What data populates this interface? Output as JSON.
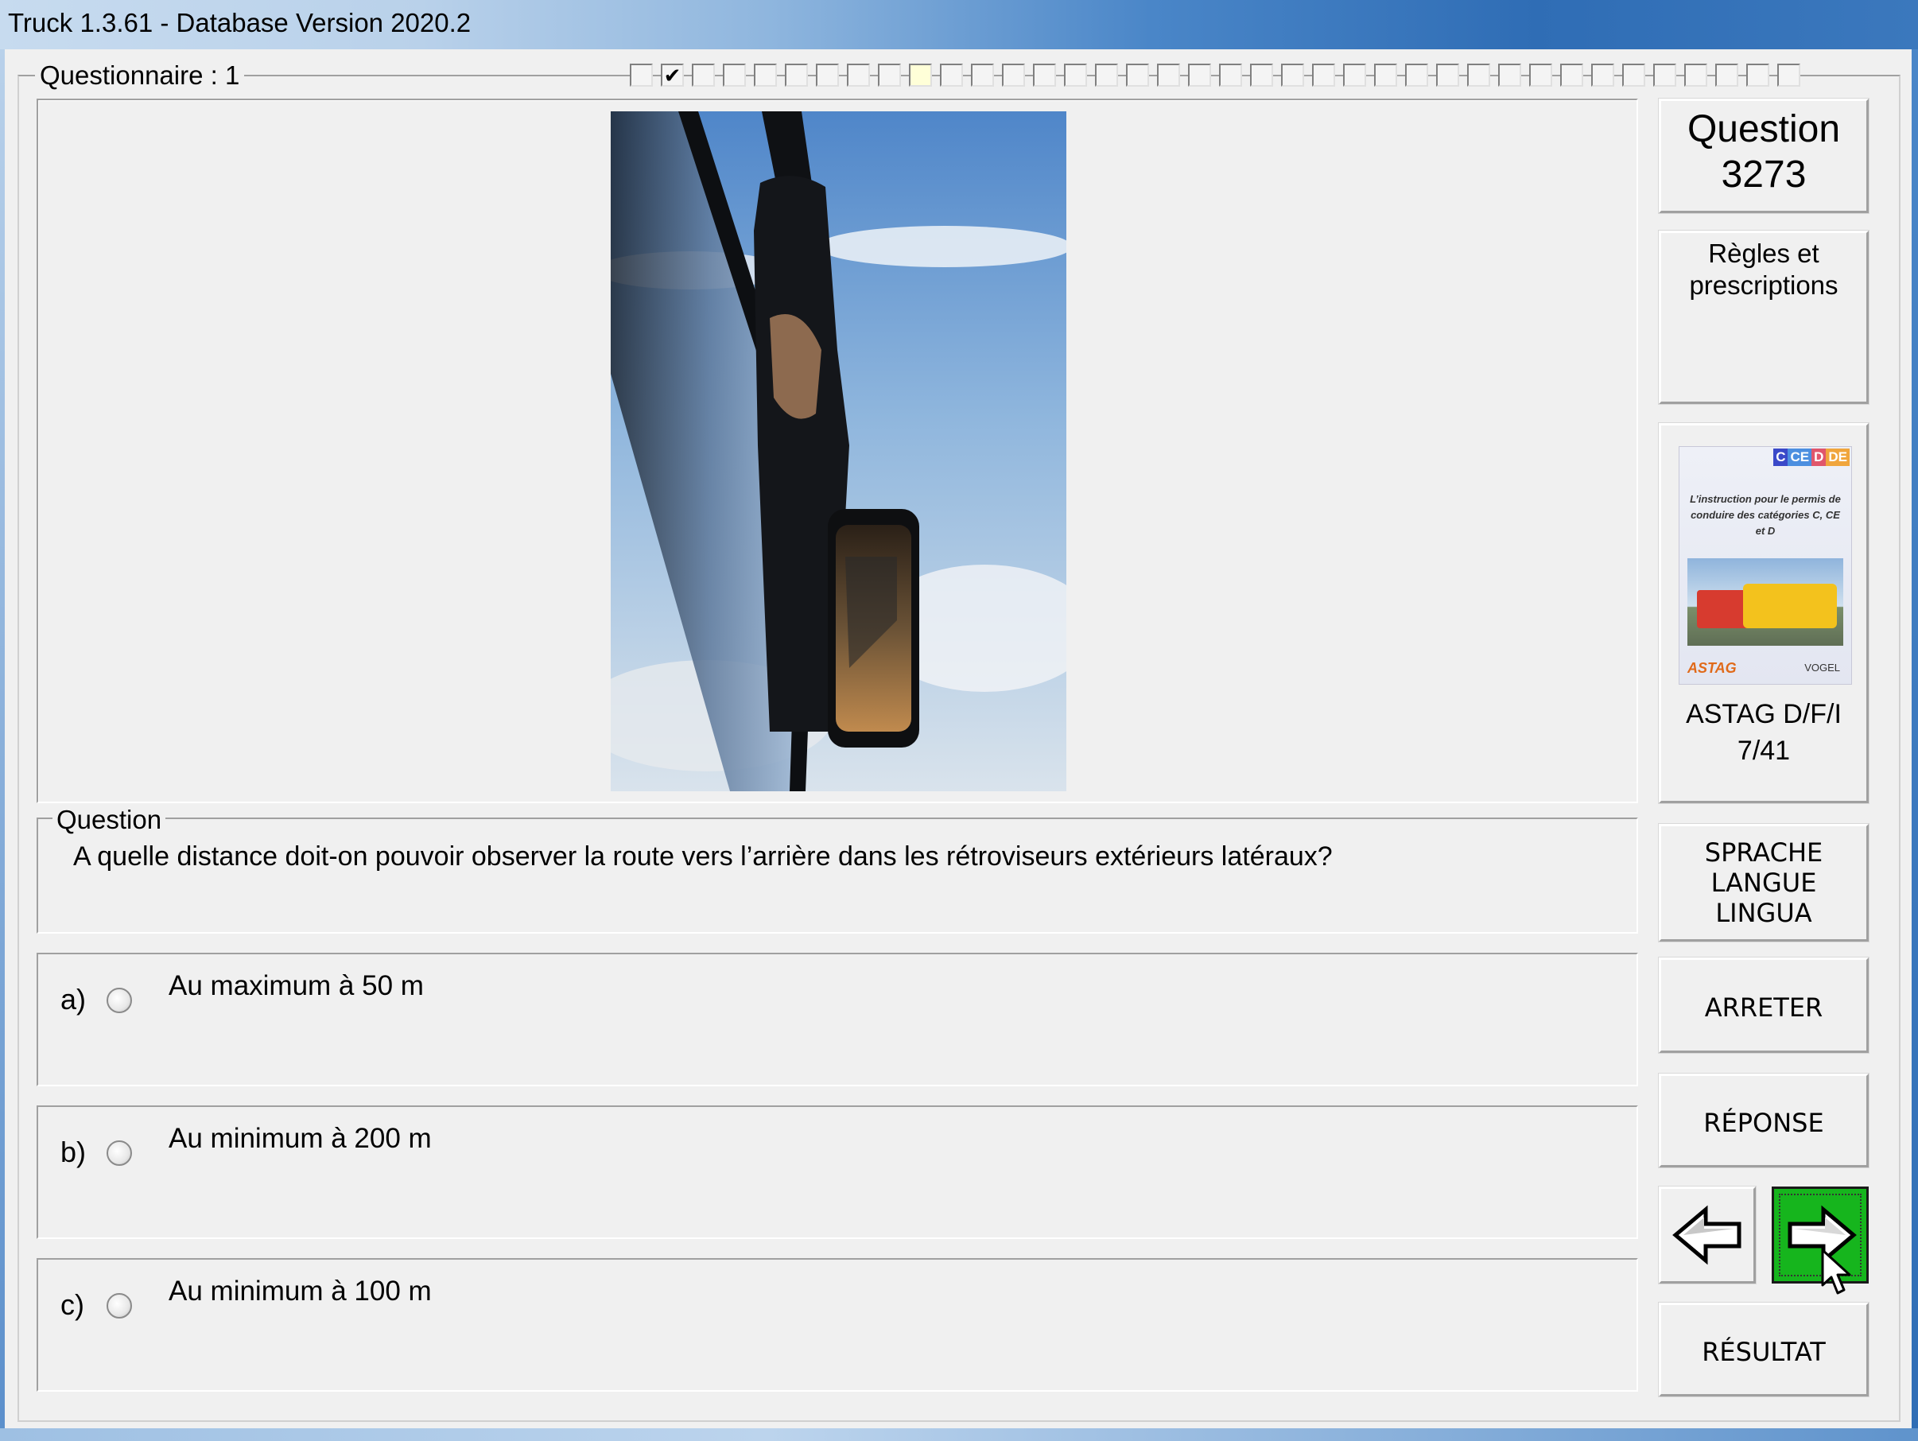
{
  "window": {
    "title": "Truck 1.3.61 - Database Version 2020.2"
  },
  "questionnaire": {
    "label": "Questionnaire : 1",
    "progress": {
      "total": 38,
      "checked_index": 1,
      "current_index": 9,
      "check_mark": "✔"
    }
  },
  "question": {
    "group_label": "Question",
    "text": "A quelle distance doit-on pouvoir observer la route vers l’arrière dans les rétroviseurs extérieurs latéraux?",
    "image_icon": "truck-side-mirror-photo"
  },
  "answers": [
    {
      "letter": "a)",
      "text": "Au maximum à 50 m",
      "selected": false
    },
    {
      "letter": "b)",
      "text": "Au minimum à 200 m",
      "selected": false
    },
    {
      "letter": "c)",
      "text": "Au minimum à 100 m",
      "selected": false
    }
  ],
  "sidebar": {
    "question_number_label": "Question",
    "question_number": "3273",
    "topic_line1": "Règles et",
    "topic_line2": "prescriptions",
    "book": {
      "categories": [
        "C",
        "CE",
        "D",
        "DE"
      ],
      "category_colors": [
        "#3a49c9",
        "#4c8fe0",
        "#e0566b",
        "#f0a53c"
      ],
      "cover_text": "L’instruction pour le permis de conduire des catégories C, CE et D",
      "logo_left": "ASTAG",
      "logo_right": "VOGEL",
      "source_line1": "ASTAG D/F/I",
      "source_line2": "7/41"
    },
    "lang_line1": "SPRACHE",
    "lang_line2": "LANGUE",
    "lang_line3": "LINGUA",
    "stop_label": "ARRETER",
    "answer_label": "RÉPONSE",
    "result_label": "RÉSULTAT",
    "prev_icon": "arrow-left-icon",
    "next_icon": "arrow-right-icon",
    "next_color": "#16b51d"
  }
}
